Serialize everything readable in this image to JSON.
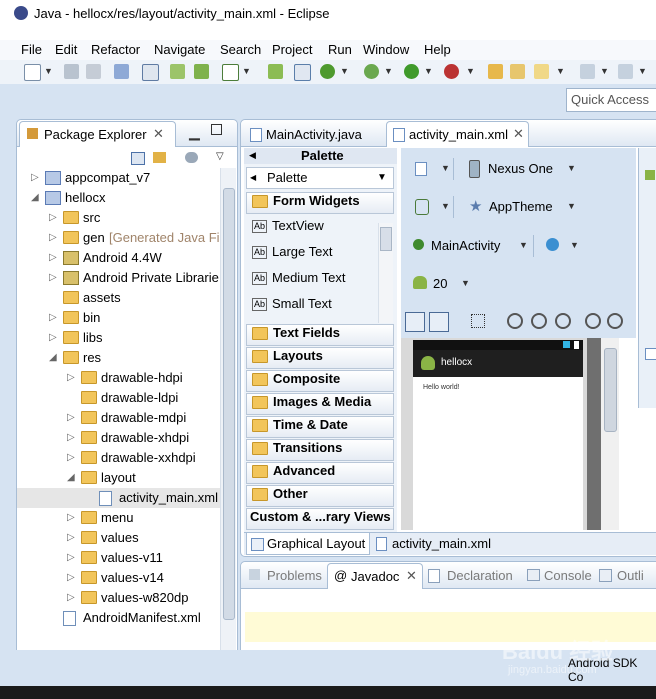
{
  "window": {
    "title": "Java - hellocx/res/layout/activity_main.xml - Eclipse"
  },
  "menu": [
    "File",
    "Edit",
    "Refactor",
    "Navigate",
    "Search",
    "Project",
    "Run",
    "Window",
    "Help"
  ],
  "quick_access": {
    "placeholder": "Quick Access"
  },
  "package_explorer": {
    "title": "Package Explorer",
    "tree": [
      {
        "label": "appcompat_v7",
        "indent": 0,
        "icon": "project-icon",
        "arrow": "▷"
      },
      {
        "label": "hellocx",
        "indent": 0,
        "icon": "project-icon",
        "arrow": "◢"
      },
      {
        "label": "src",
        "indent": 1,
        "icon": "package-folder-icon",
        "arrow": "▷"
      },
      {
        "label": "gen",
        "extra": "[Generated Java Fi",
        "indent": 1,
        "icon": "package-folder-icon",
        "arrow": "▷"
      },
      {
        "label": "Android 4.4W",
        "indent": 1,
        "icon": "library-icon",
        "arrow": "▷"
      },
      {
        "label": "Android Private Librarie",
        "indent": 1,
        "icon": "library-icon",
        "arrow": "▷"
      },
      {
        "label": "assets",
        "indent": 1,
        "icon": "folder-icon",
        "arrow": ""
      },
      {
        "label": "bin",
        "indent": 1,
        "icon": "folder-icon",
        "arrow": "▷"
      },
      {
        "label": "libs",
        "indent": 1,
        "icon": "folder-icon",
        "arrow": "▷"
      },
      {
        "label": "res",
        "indent": 1,
        "icon": "folder-icon",
        "arrow": "◢"
      },
      {
        "label": "drawable-hdpi",
        "indent": 2,
        "icon": "folder-icon",
        "arrow": "▷"
      },
      {
        "label": "drawable-ldpi",
        "indent": 2,
        "icon": "folder-icon",
        "arrow": ""
      },
      {
        "label": "drawable-mdpi",
        "indent": 2,
        "icon": "folder-icon",
        "arrow": "▷"
      },
      {
        "label": "drawable-xhdpi",
        "indent": 2,
        "icon": "folder-icon",
        "arrow": "▷"
      },
      {
        "label": "drawable-xxhdpi",
        "indent": 2,
        "icon": "folder-icon",
        "arrow": "▷"
      },
      {
        "label": "layout",
        "indent": 2,
        "icon": "folder-icon",
        "arrow": "◢"
      },
      {
        "label": "activity_main.xml",
        "indent": 3,
        "icon": "xml-file-icon",
        "arrow": "",
        "selected": true
      },
      {
        "label": "menu",
        "indent": 2,
        "icon": "folder-icon",
        "arrow": "▷"
      },
      {
        "label": "values",
        "indent": 2,
        "icon": "folder-icon",
        "arrow": "▷"
      },
      {
        "label": "values-v11",
        "indent": 2,
        "icon": "folder-icon",
        "arrow": "▷"
      },
      {
        "label": "values-v14",
        "indent": 2,
        "icon": "folder-icon",
        "arrow": "▷"
      },
      {
        "label": "values-w820dp",
        "indent": 2,
        "icon": "folder-icon",
        "arrow": "▷"
      },
      {
        "label": "AndroidManifest.xml",
        "indent": 1,
        "icon": "xml-file-icon",
        "arrow": ""
      }
    ]
  },
  "editor_tabs": [
    {
      "label": "MainActivity.java",
      "active": false
    },
    {
      "label": "activity_main.xml",
      "active": true
    }
  ],
  "palette": {
    "header": "Palette",
    "dropdown": "Palette",
    "open_category": "Form Widgets",
    "items": [
      "TextView",
      "Large Text",
      "Medium Text",
      "Small Text"
    ],
    "categories": [
      "Text Fields",
      "Layouts",
      "Composite",
      "Images & Media",
      "Time & Date",
      "Transitions",
      "Advanced",
      "Other",
      "Custom & ...rary Views"
    ]
  },
  "config": {
    "device": "Nexus One",
    "theme": "AppTheme",
    "activity": "MainActivity",
    "api_level": "20"
  },
  "preview": {
    "app_title": "hellocx",
    "content_text": "Hello world!"
  },
  "bottom_editor_tabs": [
    "Graphical Layout",
    "activity_main.xml"
  ],
  "bottom_panel_tabs": [
    "Problems",
    "Javadoc",
    "Declaration",
    "Console",
    "Outli"
  ],
  "status": {
    "text": "Android SDK Co"
  },
  "watermark": {
    "text": "Baidu 经验",
    "url": "jingyan.baidu.com"
  }
}
